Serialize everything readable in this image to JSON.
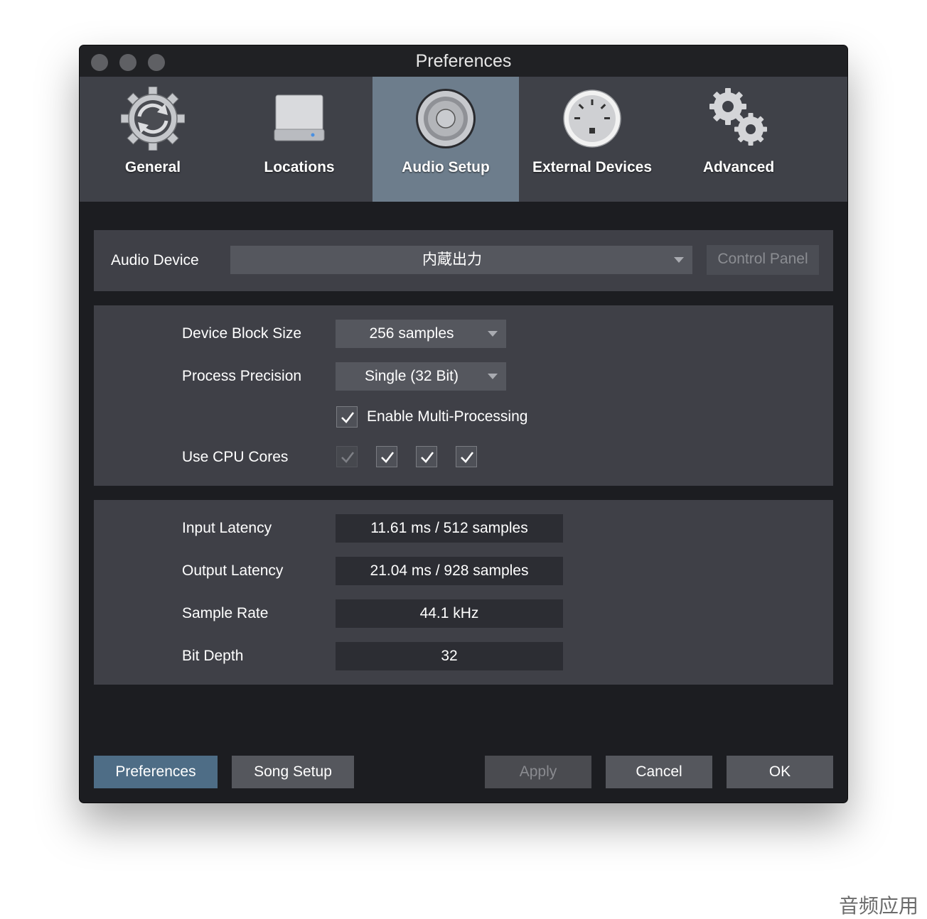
{
  "window": {
    "title": "Preferences"
  },
  "tabs": [
    {
      "label": "General",
      "icon": "gear-refresh-icon"
    },
    {
      "label": "Locations",
      "icon": "hard-drive-icon"
    },
    {
      "label": "Audio Setup",
      "icon": "speaker-icon",
      "active": true
    },
    {
      "label": "External Devices",
      "icon": "midi-connector-icon"
    },
    {
      "label": "Advanced",
      "icon": "gears-icon"
    }
  ],
  "audio_device": {
    "label": "Audio Device",
    "value": "内蔵出力",
    "control_panel_label": "Control Panel"
  },
  "processing": {
    "block_size_label": "Device Block Size",
    "block_size_value": "256 samples",
    "precision_label": "Process Precision",
    "precision_value": "Single (32 Bit)",
    "multiprocessing_label": "Enable Multi-Processing",
    "multiprocessing_checked": true,
    "cpu_cores_label": "Use CPU Cores",
    "cpu_cores": [
      true,
      true,
      true,
      true
    ]
  },
  "info": {
    "input_latency_label": "Input Latency",
    "input_latency_value": "11.61 ms / 512 samples",
    "output_latency_label": "Output Latency",
    "output_latency_value": "21.04 ms / 928 samples",
    "sample_rate_label": "Sample Rate",
    "sample_rate_value": "44.1 kHz",
    "bit_depth_label": "Bit Depth",
    "bit_depth_value": "32"
  },
  "footer": {
    "preferences_label": "Preferences",
    "song_setup_label": "Song Setup",
    "apply_label": "Apply",
    "cancel_label": "Cancel",
    "ok_label": "OK"
  },
  "watermark": "音频应用",
  "colors": {
    "active_tab": "#6d7d8c",
    "active_button": "#4e6d86",
    "panel": "#3f4047",
    "background": "#1c1d21"
  }
}
